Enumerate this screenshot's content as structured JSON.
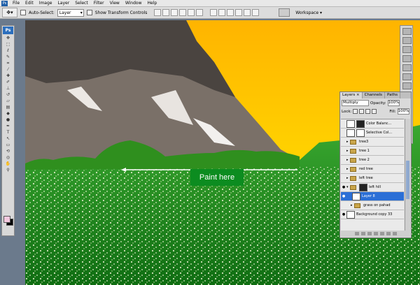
{
  "menu": {
    "items": [
      "File",
      "Edit",
      "Image",
      "Layer",
      "Select",
      "Filter",
      "View",
      "Window",
      "Help"
    ]
  },
  "options_bar": {
    "auto_select_label": "Auto-Select:",
    "auto_select_value": "Layer",
    "show_transform_label": "Show Transform Controls",
    "workspace_label": "Workspace ▾"
  },
  "toolbox": {
    "badge": "Ps",
    "tools": [
      "move-tool",
      "marquee-tool",
      "lasso-tool",
      "quick-select-tool",
      "crop-tool",
      "eyedropper-tool",
      "healing-tool",
      "brush-tool",
      "clone-stamp-tool",
      "history-brush-tool",
      "eraser-tool",
      "gradient-tool",
      "dodge-tool",
      "pen-tool",
      "type-tool",
      "path-select-tool",
      "shape-tool",
      "hand-tool",
      "zoom-tool"
    ],
    "foreground_color": "#f4c8de",
    "background_color": "#000000"
  },
  "canvas": {
    "annotation": "Paint here",
    "sky_top_color": "#ffb400",
    "sky_bottom_color": "#ffffff",
    "grass_color": "#1c8a18"
  },
  "layers_panel": {
    "tabs": [
      "Layers ×",
      "Channels",
      "Paths"
    ],
    "blend_mode": "Multiply",
    "opacity_label": "Opacity:",
    "opacity_value": "100%",
    "lock_label": "Lock:",
    "fill_label": "Fill:",
    "fill_value": "100%",
    "layers": [
      {
        "name": "Color Balanc...",
        "type": "adjustment"
      },
      {
        "name": "Selective Col...",
        "type": "adjustment"
      },
      {
        "name": "tree3",
        "type": "group"
      },
      {
        "name": "tree 1",
        "type": "group"
      },
      {
        "name": "tree 2",
        "type": "group"
      },
      {
        "name": "red tree",
        "type": "group"
      },
      {
        "name": "left tree",
        "type": "group"
      },
      {
        "name": "left hill",
        "type": "group"
      },
      {
        "name": "Layer 8",
        "type": "layer",
        "selected": true
      },
      {
        "name": "grass on pahad",
        "type": "group"
      },
      {
        "name": "Background copy 33",
        "type": "layer"
      }
    ]
  }
}
